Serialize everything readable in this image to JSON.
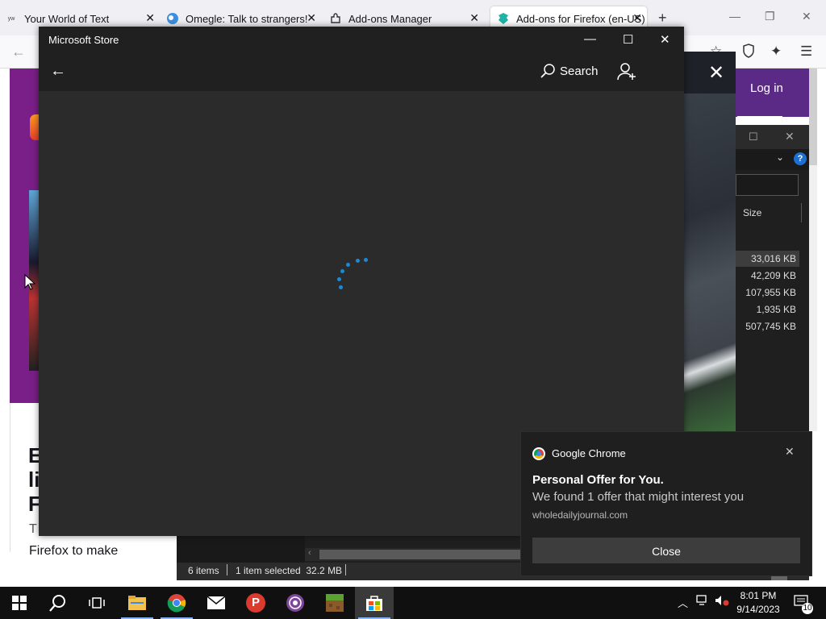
{
  "browser": {
    "tabs": [
      {
        "title": "Your World of Text",
        "active": false
      },
      {
        "title": "Omegle: Talk to strangers!",
        "active": false
      },
      {
        "title": "Add-ons Manager",
        "active": false
      },
      {
        "title": "Add-ons for Firefox (en-US)",
        "active": true
      }
    ],
    "new_tab_label": "+"
  },
  "background_page": {
    "login_label": "Log in",
    "heading_letters": [
      "E",
      "li",
      "F"
    ],
    "body_line_1": "T",
    "body_line_2": "Firefox to make"
  },
  "explorer": {
    "size_column_header": "Size",
    "sizes": [
      "33,016 KB",
      "42,209 KB",
      "107,955 KB",
      "1,935 KB",
      "507,745 KB"
    ],
    "selected_row": 0,
    "status_items": "6 items",
    "status_selected": "1 item selected  32.2 MB"
  },
  "store": {
    "window_title": "Microsoft Store",
    "search_label": "Search",
    "loading": true,
    "accent_color": "#1a8ad4"
  },
  "toast": {
    "app_name": "Google Chrome",
    "title": "Personal Offer for You.",
    "body": "We found 1 offer that might interest you",
    "source": "wholedailyjournal.com",
    "close_label": "Close"
  },
  "taskbar": {
    "apps": [
      "start-icon",
      "search-icon",
      "task-view-icon",
      "file-explorer-icon",
      "chrome-icon",
      "mail-icon",
      "psiphon-icon",
      "tor-icon",
      "minecraft-icon",
      "store-icon"
    ],
    "active_app": "store-icon",
    "time": "8:01 PM",
    "date": "9/14/2023",
    "notification_count": "10"
  }
}
